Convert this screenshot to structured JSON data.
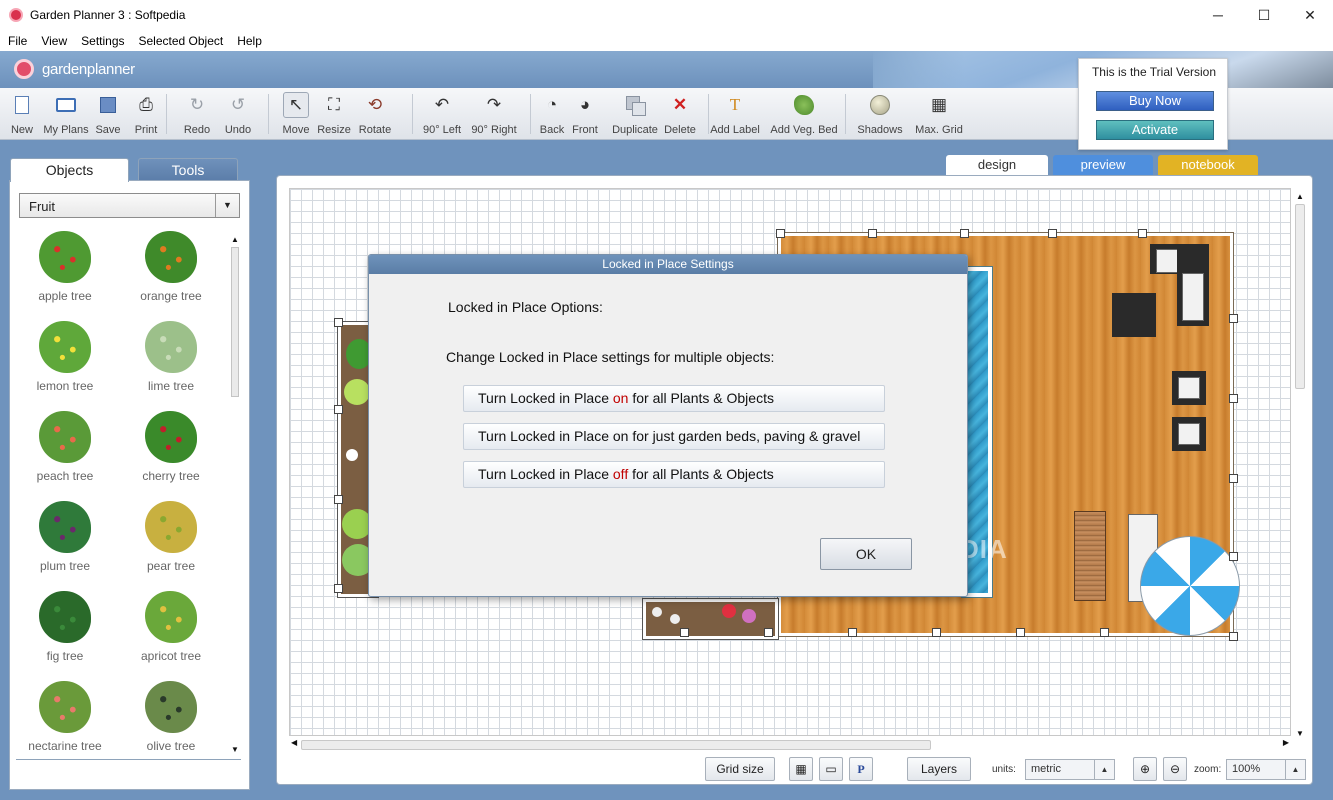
{
  "window": {
    "title": "Garden Planner 3 : Softpedia",
    "minimize": "─",
    "maximize": "☐",
    "close": "✕"
  },
  "menu": [
    "File",
    "View",
    "Settings",
    "Selected Object",
    "Help"
  ],
  "brand": {
    "name": "gardenplanner"
  },
  "toolbar": {
    "new": "New",
    "my_plans": "My Plans",
    "save": "Save",
    "print": "Print",
    "redo": "Redo",
    "undo": "Undo",
    "move": "Move",
    "resize": "Resize",
    "rotate": "Rotate",
    "rot_left": "90° Left",
    "rot_right": "90° Right",
    "back": "Back",
    "front": "Front",
    "duplicate": "Duplicate",
    "delete": "Delete",
    "add_label": "Add Label",
    "add_veg_bed": "Add Veg. Bed",
    "shadows": "Shadows",
    "max_grid": "Max. Grid"
  },
  "trial": {
    "text": "This is the Trial Version",
    "buy_now": "Buy Now",
    "activate": "Activate"
  },
  "left_panel": {
    "tabs": {
      "objects": "Objects",
      "tools": "Tools"
    },
    "category": "Fruit",
    "plants": [
      {
        "name": "apple tree",
        "color": "#4f9a32",
        "accent": "#d8322a"
      },
      {
        "name": "orange tree",
        "color": "#3f8a2a",
        "accent": "#e07a20"
      },
      {
        "name": "lemon tree",
        "color": "#5fa83a",
        "accent": "#f2e03a"
      },
      {
        "name": "lime tree",
        "color": "#9cc08a",
        "accent": "#c8dcb8"
      },
      {
        "name": "peach tree",
        "color": "#5a9a38",
        "accent": "#e86a4a"
      },
      {
        "name": "cherry tree",
        "color": "#3a8a2a",
        "accent": "#c0202a"
      },
      {
        "name": "plum tree",
        "color": "#2f7a3a",
        "accent": "#6a2a6a"
      },
      {
        "name": "pear tree",
        "color": "#c8b040",
        "accent": "#8aa830"
      },
      {
        "name": "fig tree",
        "color": "#2a6a2a",
        "accent": "#3a8a3a"
      },
      {
        "name": "apricot tree",
        "color": "#6aa83a",
        "accent": "#e0c040"
      },
      {
        "name": "nectarine tree",
        "color": "#6a9a3a",
        "accent": "#e87a6a"
      },
      {
        "name": "olive tree",
        "color": "#6a8a4a",
        "accent": "#2a3a2a"
      }
    ]
  },
  "view_tabs": {
    "design": "design",
    "preview": "preview",
    "notebook": "notebook"
  },
  "bottom_bar": {
    "grid_size": "Grid size",
    "layers": "Layers",
    "units_label": "units:",
    "units_value": "metric",
    "zoom_label": "zoom:",
    "zoom_value": "100%",
    "p_icon": "P"
  },
  "dialog": {
    "title": "Locked in Place Settings",
    "heading": "Locked in Place Options:",
    "subheading": "Change Locked in Place settings for multiple objects:",
    "opt1_pre": "Turn Locked in Place ",
    "opt1_kw": "on",
    "opt1_post": " for all Plants & Objects",
    "opt2": "Turn Locked in Place on for just garden beds, paving & gravel",
    "opt3_pre": "Turn Locked in Place ",
    "opt3_kw": "off",
    "opt3_post": " for all Plants & Objects",
    "ok": "OK"
  },
  "watermark": "SOFTPEDIA",
  "colors": {
    "accent": "#5a7da6",
    "keyword": "#c00000",
    "buy": "#2f5fbf",
    "activate": "#2f8f9f"
  }
}
